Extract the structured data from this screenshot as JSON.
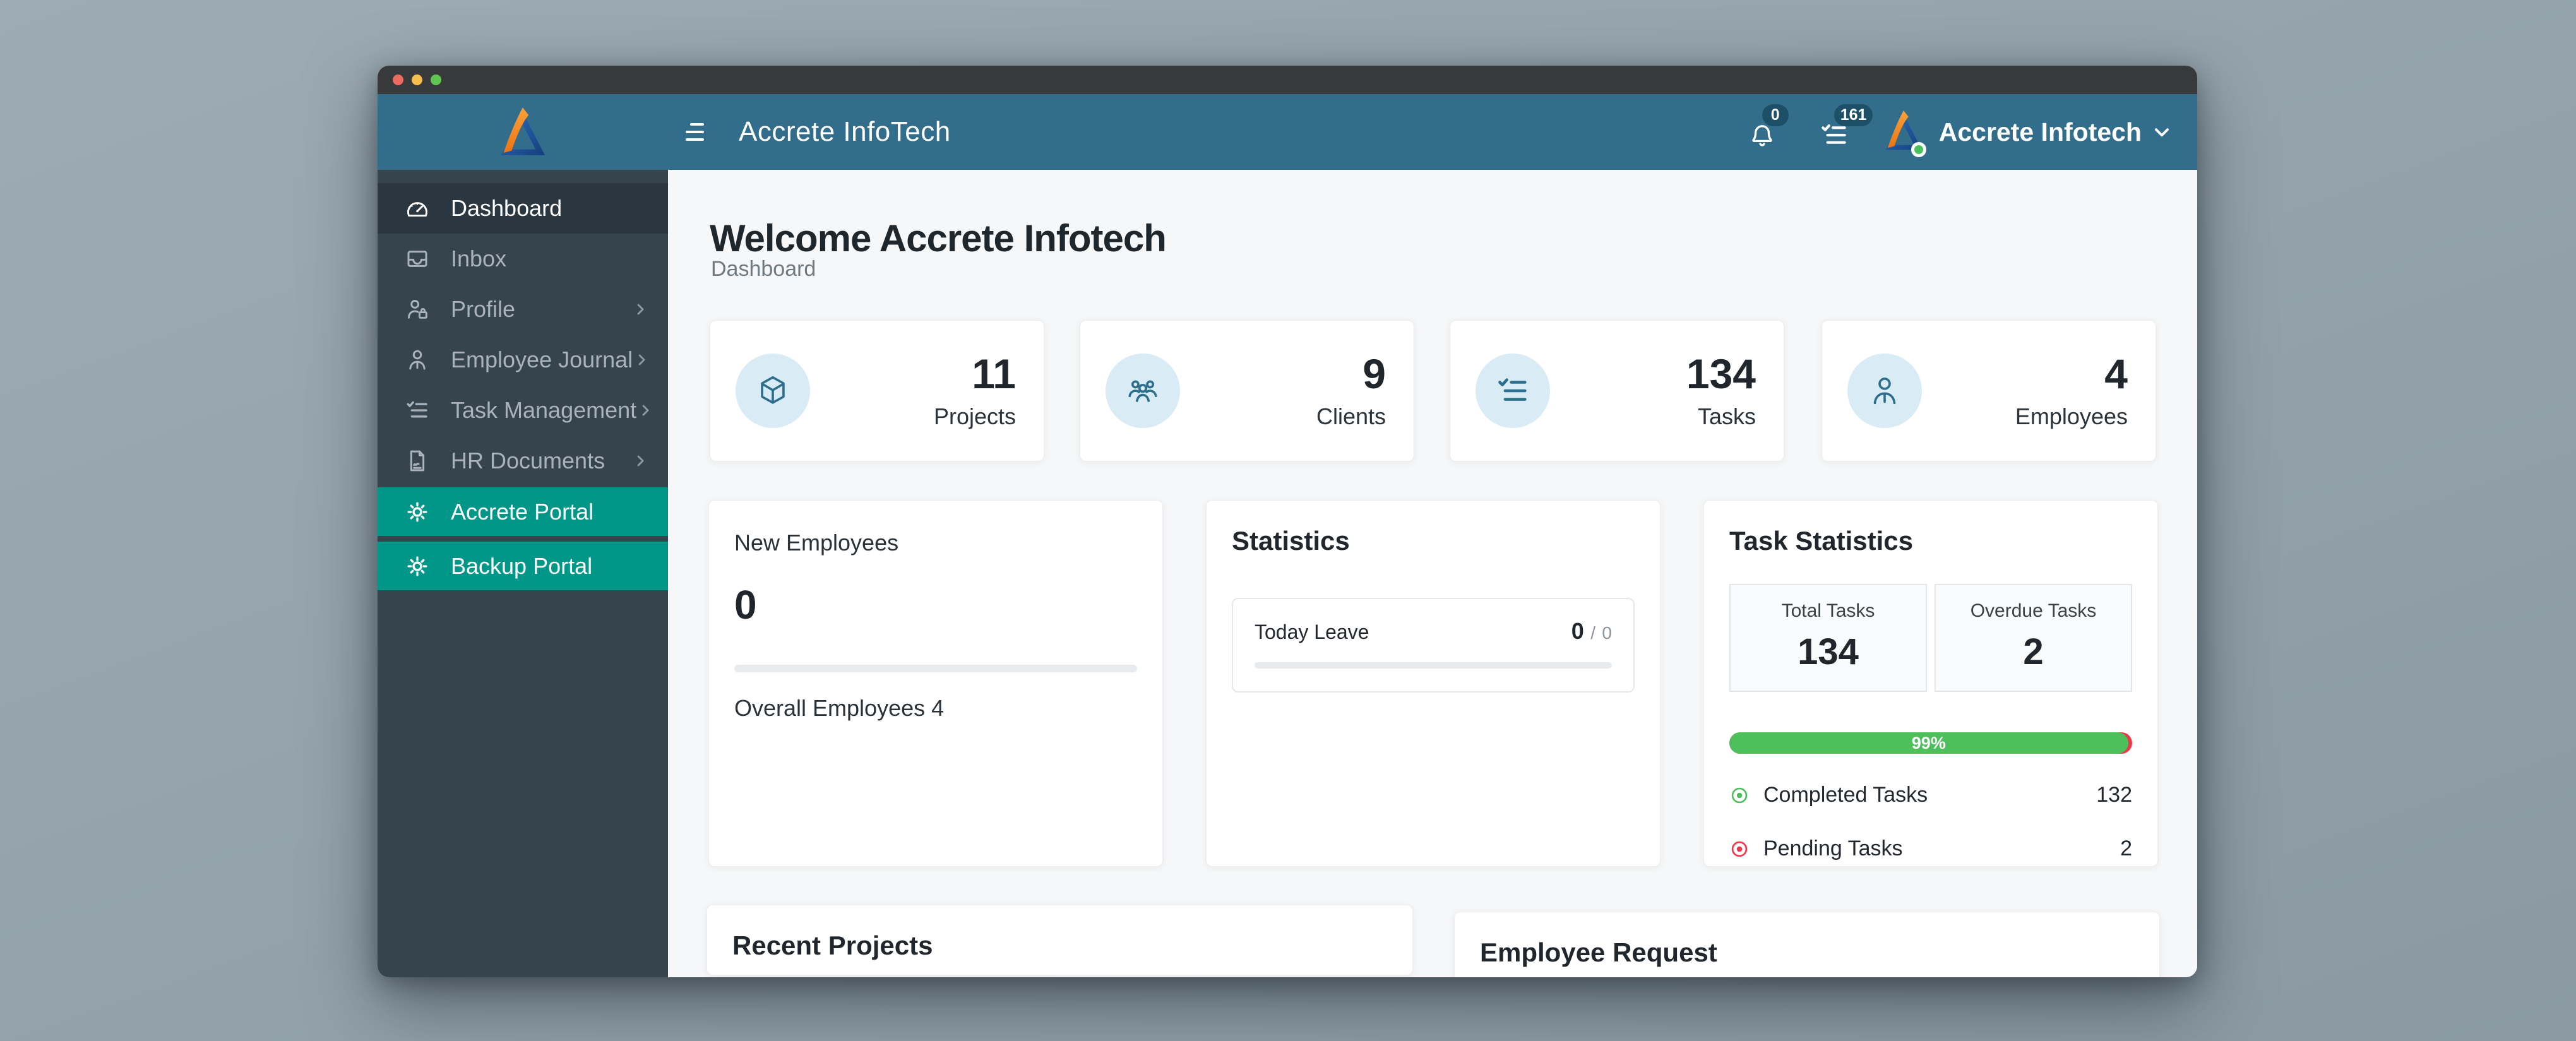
{
  "navbar": {
    "app_title": "Accrete InfoTech",
    "notifications_badge": "0",
    "tasks_badge": "161",
    "user_name": "Accrete Infotech"
  },
  "sidebar": {
    "items": [
      {
        "label": "Dashboard",
        "active": true
      },
      {
        "label": "Inbox"
      },
      {
        "label": "Profile",
        "expandable": true
      },
      {
        "label": "Employee Journal",
        "expandable": true
      },
      {
        "label": "Task Management",
        "expandable": true
      },
      {
        "label": "HR Documents",
        "expandable": true
      },
      {
        "label": "Accrete Portal",
        "highlight": true
      },
      {
        "label": "Backup Portal",
        "highlight": true
      }
    ]
  },
  "page": {
    "heading": "Welcome Accrete Infotech",
    "breadcrumb": "Dashboard"
  },
  "stat_cards": [
    {
      "value": "11",
      "label": "Projects",
      "icon": "cube-icon"
    },
    {
      "value": "9",
      "label": "Clients",
      "icon": "clients-group-icon"
    },
    {
      "value": "134",
      "label": "Tasks",
      "icon": "task-list-icon"
    },
    {
      "value": "4",
      "label": "Employees",
      "icon": "person-icon"
    }
  ],
  "new_employees": {
    "title": "New Employees",
    "value": "0",
    "overall": "Overall Employees 4",
    "progress_percent": 0
  },
  "statistics": {
    "title": "Statistics",
    "leave_label": "Today Leave",
    "leave_value": "0",
    "leave_separator": "/",
    "leave_total": "0",
    "progress_percent": 0
  },
  "task_statistics": {
    "title": "Task Statistics",
    "boxes": [
      {
        "label": "Total Tasks",
        "value": "134"
      },
      {
        "label": "Overdue Tasks",
        "value": "2"
      }
    ],
    "progress": {
      "percent": 99,
      "label": "99%",
      "fill_color": "#4dc05c",
      "remainder_color": "#f2354b"
    },
    "rows": [
      {
        "label": "Completed Tasks",
        "value": "132",
        "color": "#4dc05c"
      },
      {
        "label": "Pending Tasks",
        "value": "2",
        "color": "#f2354b"
      }
    ]
  },
  "recent_projects": {
    "title": "Recent Projects"
  },
  "employee_request": {
    "title": "Employee Request"
  },
  "colors": {
    "navbar": "#326e8c",
    "sidebar": "#35444d",
    "sidebar_active": "#2a3741",
    "portal_highlight": "#009688",
    "stat_icon_bg": "#d9ebf4",
    "stat_icon_stroke": "#2d6e8f",
    "badge_bg": "#1d4f66",
    "progress_green": "#4dc05c",
    "progress_red": "#f2354b"
  }
}
